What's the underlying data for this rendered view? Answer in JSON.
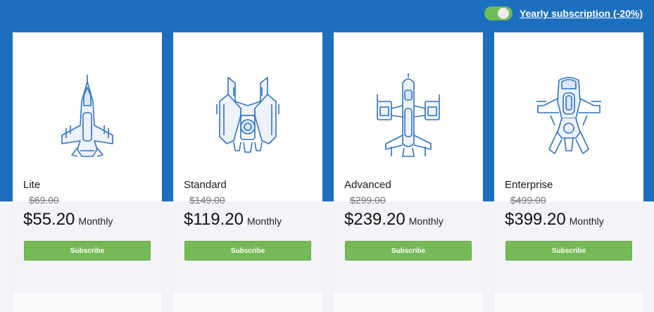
{
  "header": {
    "toggle_label": "Yearly subscription (-20%)",
    "toggle_on": true
  },
  "colors": {
    "header_blue": "#1c6ebf",
    "button_green": "#76b957",
    "icon_blue": "#2f73c4"
  },
  "plans": [
    {
      "name": "Lite",
      "old_price": "$69.00",
      "price": "$55.20",
      "period": "Monthly",
      "button": "Subscribe",
      "icon": "fighter-jet-icon"
    },
    {
      "name": "Standard",
      "old_price": "$149.00",
      "price": "$119.20",
      "period": "Monthly",
      "button": "Subscribe",
      "icon": "spaceship-icon"
    },
    {
      "name": "Advanced",
      "old_price": "$299.00",
      "price": "$239.20",
      "period": "Monthly",
      "button": "Subscribe",
      "icon": "cruiser-icon"
    },
    {
      "name": "Enterprise",
      "old_price": "$499.00",
      "price": "$399.20",
      "period": "Monthly",
      "button": "Subscribe",
      "icon": "mothership-icon"
    }
  ]
}
